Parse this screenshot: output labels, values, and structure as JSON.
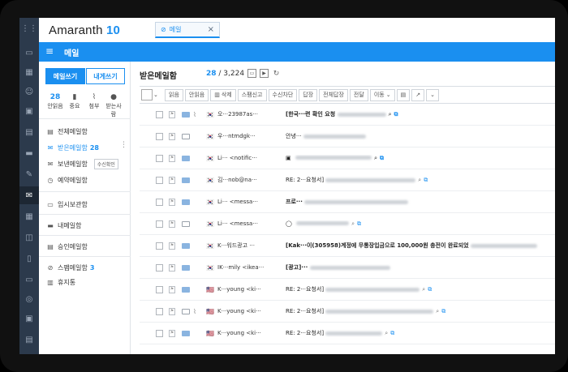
{
  "app": {
    "logo_text": "Amaranth",
    "logo_num": "10",
    "tab_label": "메일",
    "tab_close": "×"
  },
  "header": {
    "title": "메일"
  },
  "sidebar": {
    "write_button": "메일쓰기",
    "self_write_button": "내게쓰기",
    "quick": [
      {
        "top": "28",
        "label": "안읽음"
      },
      {
        "icon": "bookmark-icon",
        "label": "중요"
      },
      {
        "icon": "paperclip-icon",
        "label": "첨부"
      },
      {
        "icon": "person-icon",
        "label": "받는사람"
      }
    ],
    "folders": [
      {
        "label": "전체메일함"
      },
      {
        "label": "받은메일함",
        "count": "28"
      },
      {
        "label": "보낸메일함",
        "badge": "수신확인"
      },
      {
        "label": "예약메일함"
      },
      {
        "label": "임시보관함"
      },
      {
        "label": "내메일함"
      },
      {
        "label": "승인메일함"
      },
      {
        "label": "스팸메일함",
        "count": "3"
      },
      {
        "label": "휴지통"
      }
    ]
  },
  "main": {
    "title": "받은메일함",
    "unread": "28",
    "separator": " / ",
    "total": "3,224",
    "toolbar": [
      "읽음",
      "안읽음",
      "삭제",
      "스팸신고",
      "수신차단",
      "답장",
      "전체답장",
      "전달",
      "이동"
    ]
  },
  "rows": [
    {
      "sender": "오···23987as···",
      "subject": "[한국···련 확인 요청",
      "unread": true,
      "attach": true,
      "bold": true,
      "mini": true
    },
    {
      "sender": "우···ntmdgk···",
      "subject": "안녕···",
      "unread": false,
      "attach": false,
      "bold": false,
      "mini": false
    },
    {
      "sender": "Li··· <notific···",
      "subject": "",
      "unread": true,
      "attach": false,
      "bold": true,
      "mini": true,
      "box": true
    },
    {
      "sender": "김···nob@na···",
      "subject": "RE: 2···요청서]",
      "unread": true,
      "attach": false,
      "bold": false,
      "mini": true
    },
    {
      "sender": "Li··· <messa···",
      "subject": "프로···",
      "unread": true,
      "attach": false,
      "bold": true,
      "mini": false
    },
    {
      "sender": "Li··· <messa···",
      "subject": "",
      "unread": false,
      "attach": false,
      "bold": false,
      "mini": true,
      "bubble": true
    },
    {
      "sender": "K···워드광고 ···",
      "subject": "[Kak···이(305958)계정에 무통장입금으로 100,000원 충전이 완료되었",
      "unread": true,
      "attach": false,
      "bold": true,
      "mini": false
    },
    {
      "sender": "IK···mily <ikea···",
      "subject": "[광고]···",
      "unread": true,
      "attach": false,
      "bold": true,
      "mini": false
    },
    {
      "sender": "K···young <ki···",
      "subject": "RE: 2···요청서]",
      "unread": true,
      "attach": false,
      "bold": false,
      "mini": true
    },
    {
      "sender": "K···young <ki···",
      "subject": "RE: 2···요청서]",
      "unread": false,
      "attach": true,
      "bold": false,
      "mini": true
    },
    {
      "sender": "K···young <ki···",
      "subject": "RE: 2···요청서]",
      "unread": true,
      "attach": false,
      "bold": false,
      "mini": true
    }
  ],
  "colors": {
    "accent": "#1a8ff0",
    "rail": "#2c3a4c"
  }
}
